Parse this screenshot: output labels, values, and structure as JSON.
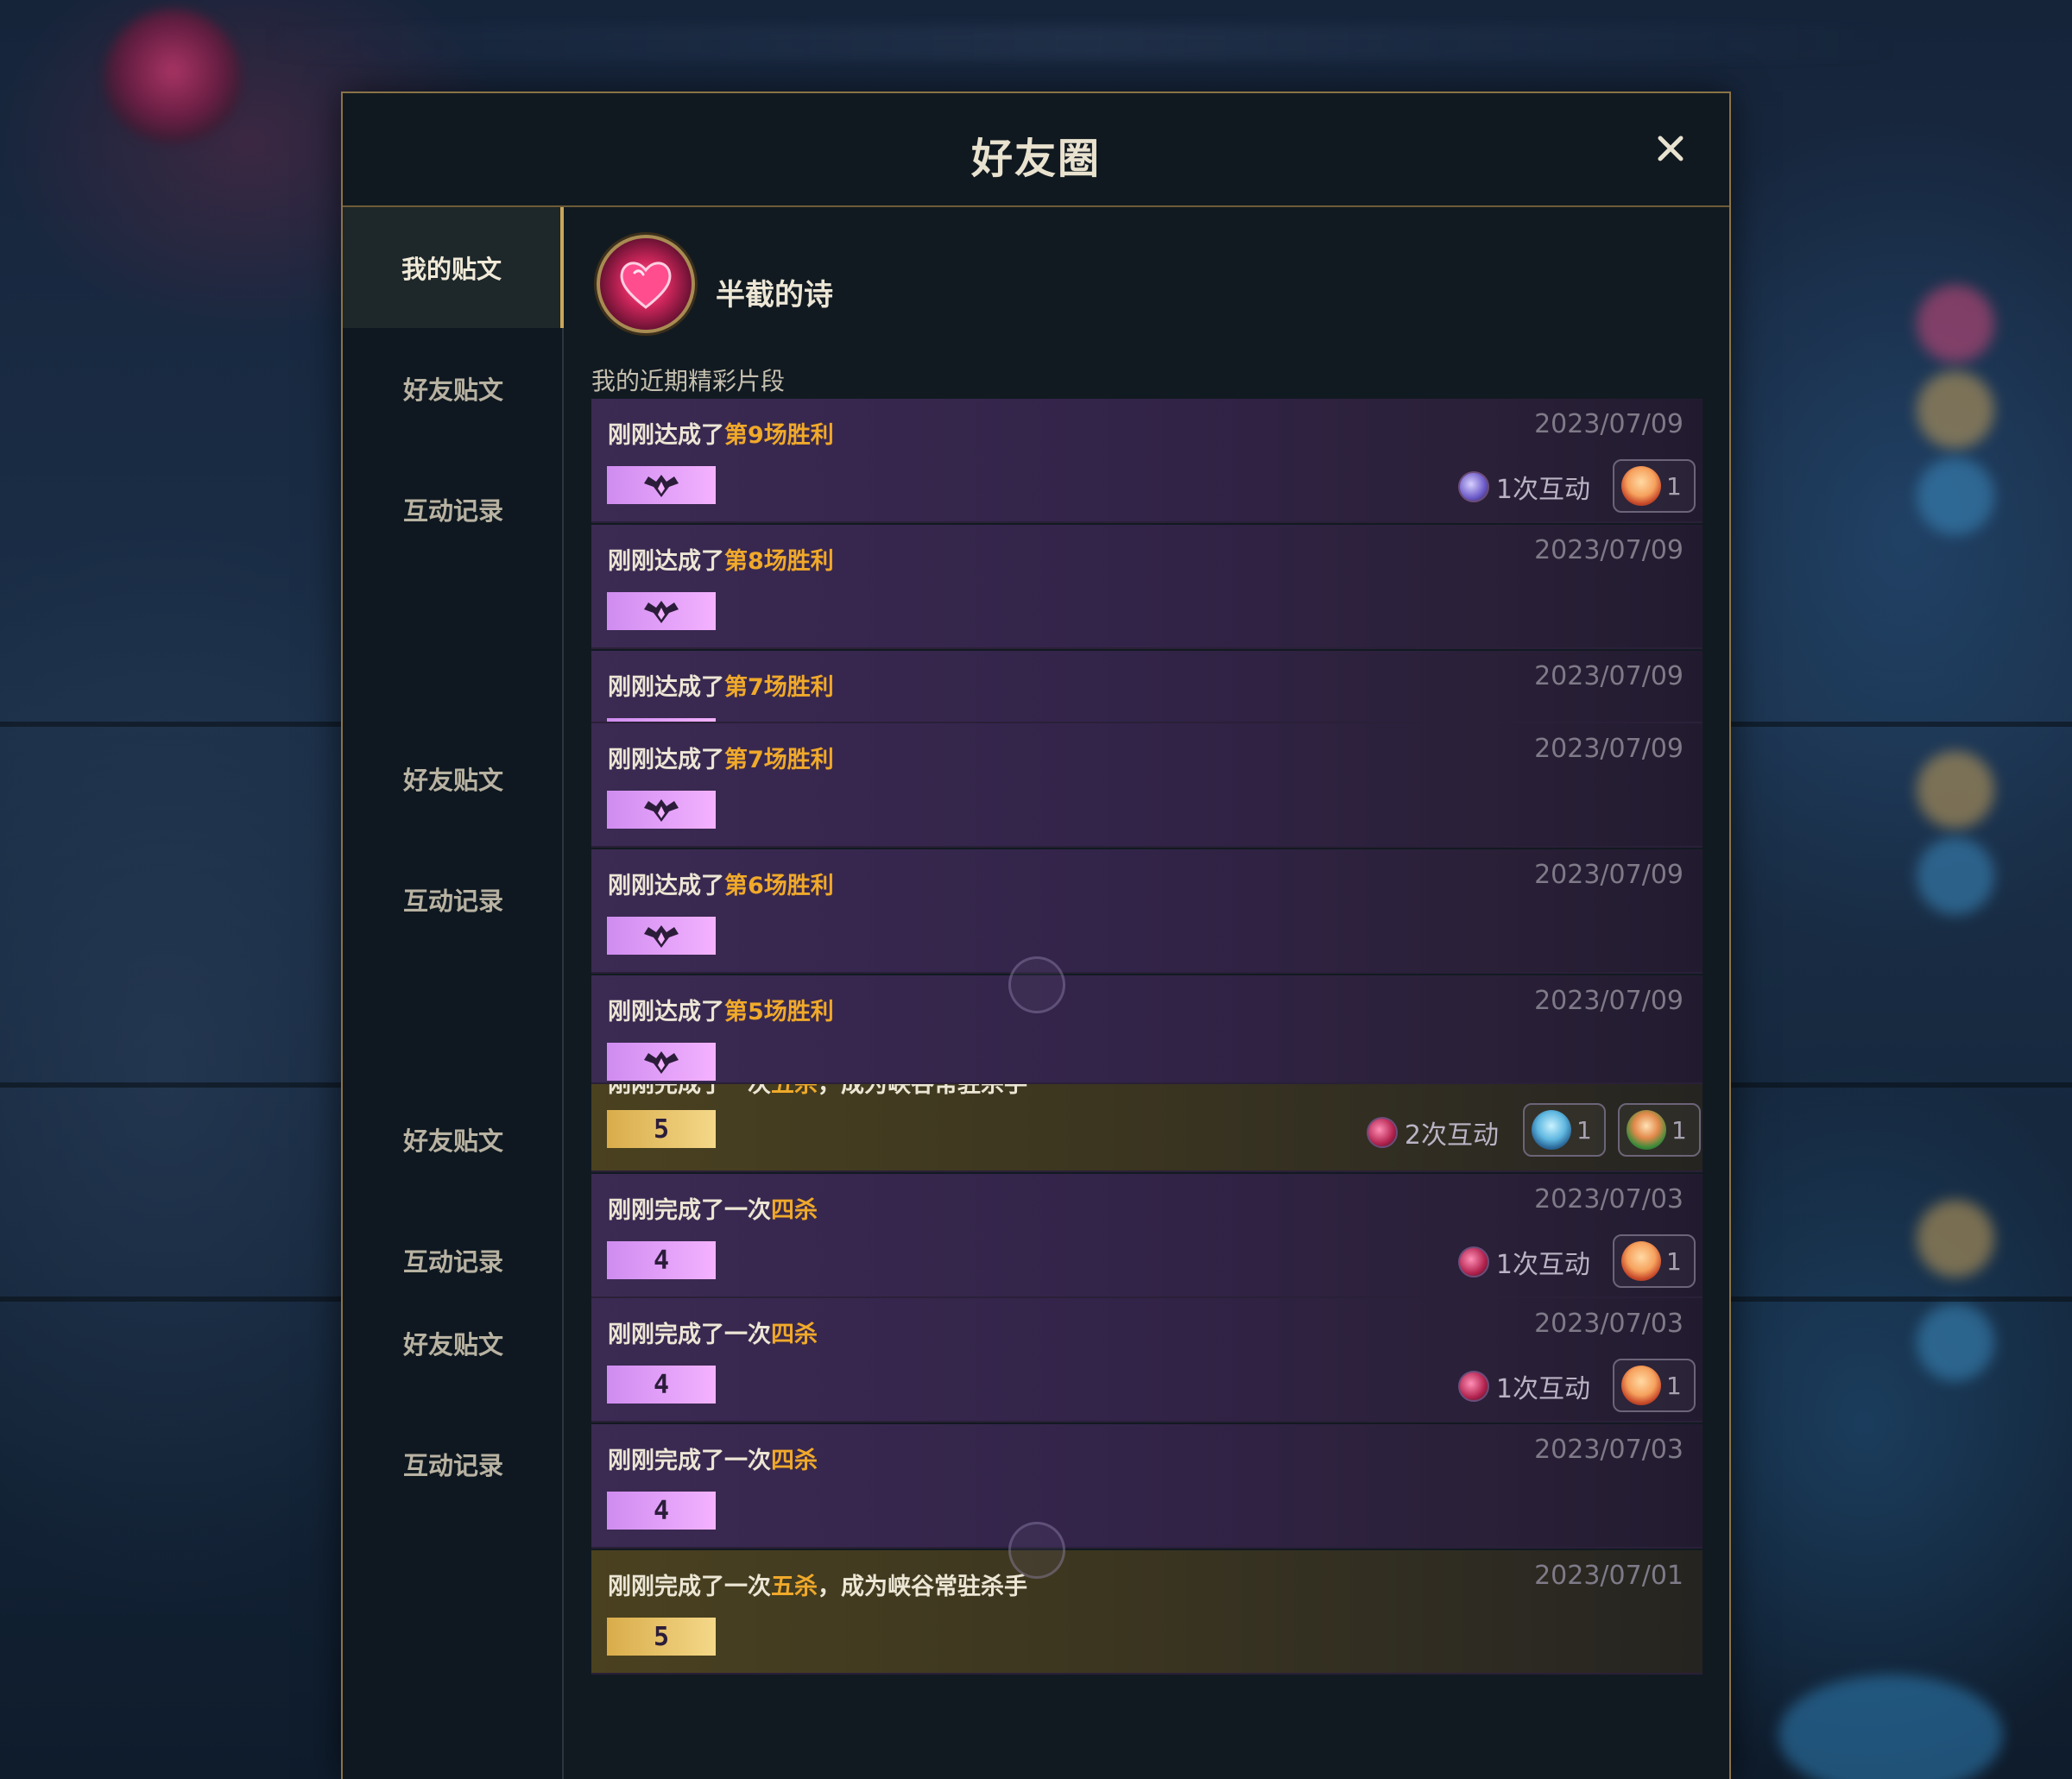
{
  "dialog": {
    "title": "好友圈",
    "close_label": "✕"
  },
  "sidebar": {
    "items": [
      {
        "label": "我的贴文",
        "active": true
      },
      {
        "label": "好友贴文"
      },
      {
        "label": "互动记录"
      },
      {
        "label": "好友贴文"
      },
      {
        "label": "互动记录"
      },
      {
        "label": "好友贴文"
      },
      {
        "label": "互动记录"
      },
      {
        "label": "好友贴文"
      },
      {
        "label": "互动记录"
      }
    ]
  },
  "profile": {
    "name": "半截的诗",
    "avatar_icon": "heart-emblem-icon"
  },
  "section_label": "我的近期精彩片段",
  "colors": {
    "accent_gold": "#f0a92a",
    "frame_gold": "#8a7346",
    "purple_card": "#3b2a52",
    "gold_card": "#4a4120"
  },
  "posts": [
    {
      "prefix": "刚刚达成了",
      "highlight": "第9场胜利",
      "date": "2023/07/09",
      "badge_icon": "wings-icon",
      "interactions": "1次互动",
      "reactions": [
        {
          "count": "1"
        }
      ]
    },
    {
      "prefix": "刚刚达成了",
      "highlight": "第8场胜利",
      "date": "2023/07/09",
      "badge_icon": "wings-icon"
    },
    {
      "prefix": "刚刚达成了",
      "highlight": "第7场胜利",
      "date": "2023/07/09"
    },
    {
      "prefix": "刚刚达成了",
      "highlight": "第7场胜利",
      "date": "2023/07/09",
      "badge_icon": "wings-icon"
    },
    {
      "prefix": "刚刚达成了",
      "highlight": "第6场胜利",
      "date": "2023/07/09",
      "badge_icon": "wings-icon"
    },
    {
      "prefix": "刚刚达成了",
      "highlight": "第5场胜利",
      "date": "2023/07/09",
      "badge_icon": "wings-icon"
    },
    {
      "prefix": "刚刚完成了一次",
      "highlight": "五杀",
      "suffix": "，成为峡谷常驻杀手",
      "badge": "5",
      "interactions": "2次互动",
      "reactions": [
        {
          "count": "1"
        },
        {
          "count": "1"
        }
      ]
    },
    {
      "prefix": "刚刚完成了一次",
      "highlight": "四杀",
      "date": "2023/07/03",
      "badge": "4",
      "interactions": "1次互动",
      "reactions": [
        {
          "count": "1"
        }
      ]
    },
    {
      "prefix": "刚刚完成了一次",
      "highlight": "四杀",
      "date": "2023/07/03",
      "badge": "4",
      "interactions": "1次互动",
      "reactions": [
        {
          "count": "1"
        }
      ]
    },
    {
      "prefix": "刚刚完成了一次",
      "highlight": "四杀",
      "date": "2023/07/03",
      "badge": "4"
    },
    {
      "prefix": "刚刚完成了一次",
      "highlight": "五杀",
      "suffix": "，成为峡谷常驻杀手",
      "date": "2023/07/01",
      "badge": "5"
    }
  ]
}
